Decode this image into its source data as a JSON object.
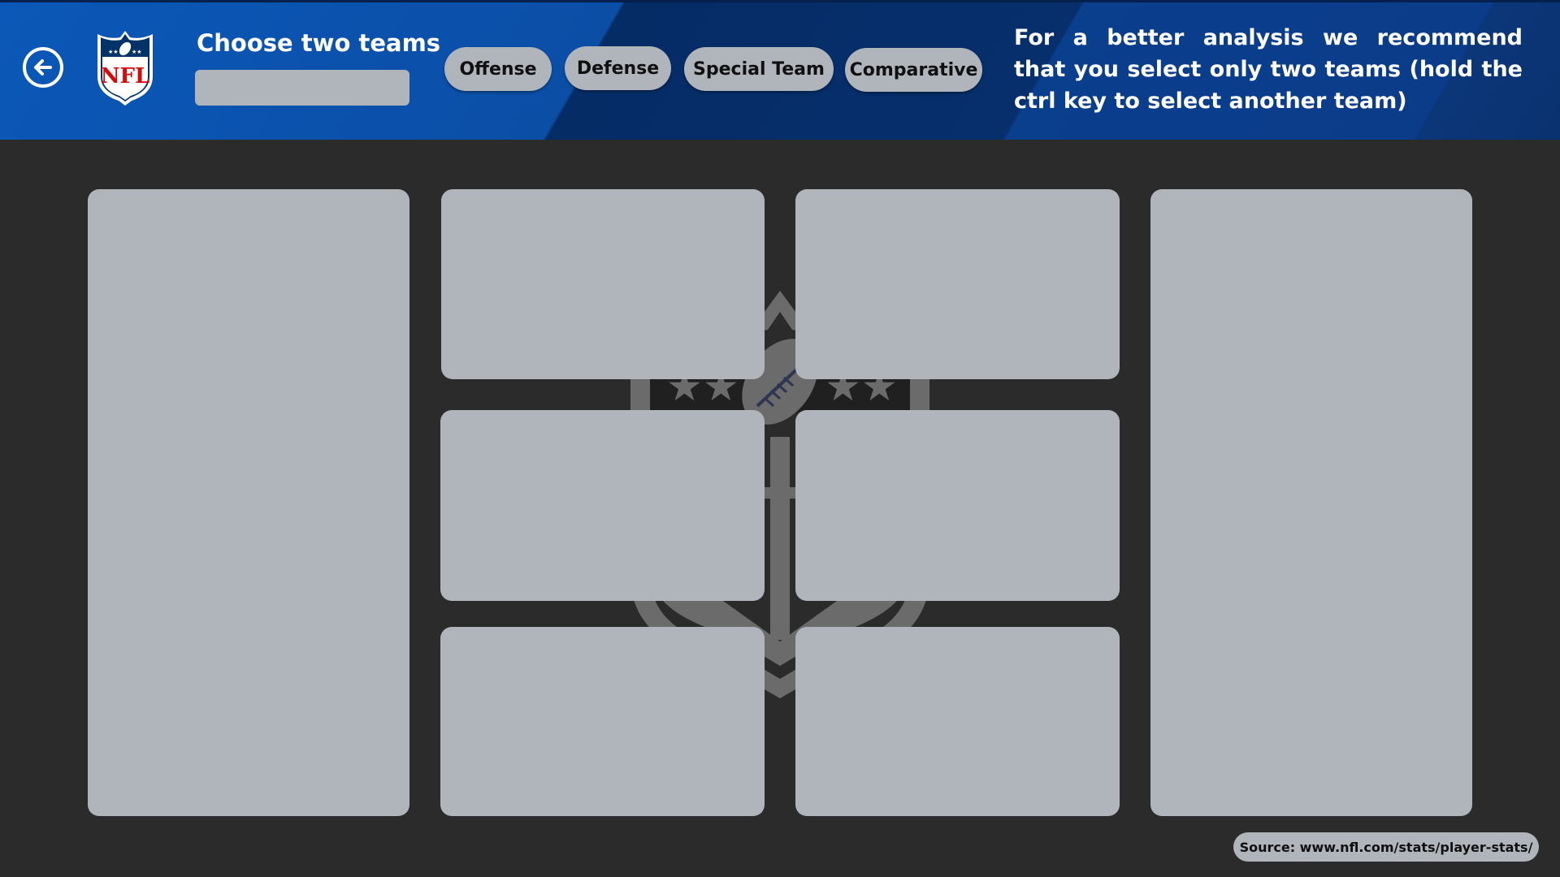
{
  "header": {
    "choose_label": "Choose two teams",
    "team_select_value": "",
    "logo_text": "NFL",
    "notice": "For a better analysis we recommend that you select only two teams (hold the ctrl key to select another team)"
  },
  "nav": {
    "offense": "Offense",
    "defense": "Defense",
    "special_team": "Special Team",
    "comparative": "Comparative"
  },
  "footer": {
    "source": "Source: www.nfl.com/stats/player-stats/"
  },
  "icons": {
    "back": "arrow-left-circle-icon",
    "logo": "nfl-shield-logo",
    "watermark": "nfl-shield-watermark"
  },
  "colors": {
    "header_blue": "#0b58b8",
    "header_dark_blue": "#062c66",
    "background": "#2b2b2b",
    "panel": "#b0b5bb",
    "nfl_red": "#d50a0a"
  }
}
